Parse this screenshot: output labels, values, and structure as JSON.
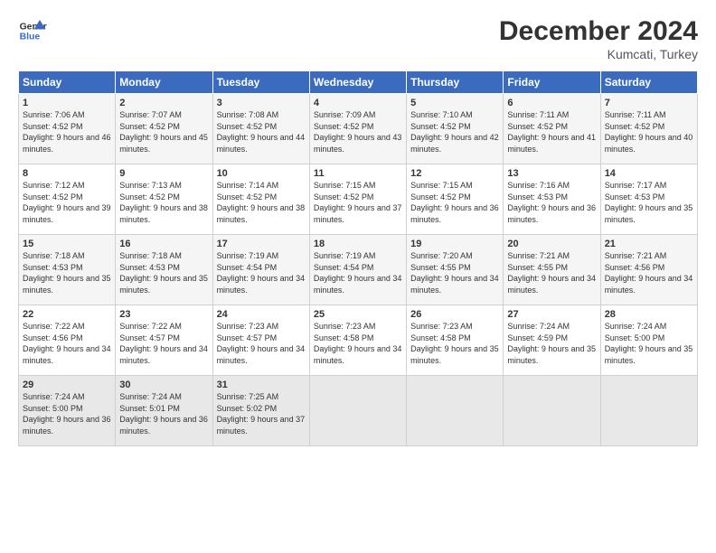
{
  "header": {
    "logo_line1": "General",
    "logo_line2": "Blue",
    "month": "December 2024",
    "location": "Kumcati, Turkey"
  },
  "weekdays": [
    "Sunday",
    "Monday",
    "Tuesday",
    "Wednesday",
    "Thursday",
    "Friday",
    "Saturday"
  ],
  "weeks": [
    [
      {
        "day": "1",
        "sunrise": "7:06 AM",
        "sunset": "4:52 PM",
        "daylight": "9 hours and 46 minutes."
      },
      {
        "day": "2",
        "sunrise": "7:07 AM",
        "sunset": "4:52 PM",
        "daylight": "9 hours and 45 minutes."
      },
      {
        "day": "3",
        "sunrise": "7:08 AM",
        "sunset": "4:52 PM",
        "daylight": "9 hours and 44 minutes."
      },
      {
        "day": "4",
        "sunrise": "7:09 AM",
        "sunset": "4:52 PM",
        "daylight": "9 hours and 43 minutes."
      },
      {
        "day": "5",
        "sunrise": "7:10 AM",
        "sunset": "4:52 PM",
        "daylight": "9 hours and 42 minutes."
      },
      {
        "day": "6",
        "sunrise": "7:11 AM",
        "sunset": "4:52 PM",
        "daylight": "9 hours and 41 minutes."
      },
      {
        "day": "7",
        "sunrise": "7:11 AM",
        "sunset": "4:52 PM",
        "daylight": "9 hours and 40 minutes."
      }
    ],
    [
      {
        "day": "8",
        "sunrise": "7:12 AM",
        "sunset": "4:52 PM",
        "daylight": "9 hours and 39 minutes."
      },
      {
        "day": "9",
        "sunrise": "7:13 AM",
        "sunset": "4:52 PM",
        "daylight": "9 hours and 38 minutes."
      },
      {
        "day": "10",
        "sunrise": "7:14 AM",
        "sunset": "4:52 PM",
        "daylight": "9 hours and 38 minutes."
      },
      {
        "day": "11",
        "sunrise": "7:15 AM",
        "sunset": "4:52 PM",
        "daylight": "9 hours and 37 minutes."
      },
      {
        "day": "12",
        "sunrise": "7:15 AM",
        "sunset": "4:52 PM",
        "daylight": "9 hours and 36 minutes."
      },
      {
        "day": "13",
        "sunrise": "7:16 AM",
        "sunset": "4:53 PM",
        "daylight": "9 hours and 36 minutes."
      },
      {
        "day": "14",
        "sunrise": "7:17 AM",
        "sunset": "4:53 PM",
        "daylight": "9 hours and 35 minutes."
      }
    ],
    [
      {
        "day": "15",
        "sunrise": "7:18 AM",
        "sunset": "4:53 PM",
        "daylight": "9 hours and 35 minutes."
      },
      {
        "day": "16",
        "sunrise": "7:18 AM",
        "sunset": "4:53 PM",
        "daylight": "9 hours and 35 minutes."
      },
      {
        "day": "17",
        "sunrise": "7:19 AM",
        "sunset": "4:54 PM",
        "daylight": "9 hours and 34 minutes."
      },
      {
        "day": "18",
        "sunrise": "7:19 AM",
        "sunset": "4:54 PM",
        "daylight": "9 hours and 34 minutes."
      },
      {
        "day": "19",
        "sunrise": "7:20 AM",
        "sunset": "4:55 PM",
        "daylight": "9 hours and 34 minutes."
      },
      {
        "day": "20",
        "sunrise": "7:21 AM",
        "sunset": "4:55 PM",
        "daylight": "9 hours and 34 minutes."
      },
      {
        "day": "21",
        "sunrise": "7:21 AM",
        "sunset": "4:56 PM",
        "daylight": "9 hours and 34 minutes."
      }
    ],
    [
      {
        "day": "22",
        "sunrise": "7:22 AM",
        "sunset": "4:56 PM",
        "daylight": "9 hours and 34 minutes."
      },
      {
        "day": "23",
        "sunrise": "7:22 AM",
        "sunset": "4:57 PM",
        "daylight": "9 hours and 34 minutes."
      },
      {
        "day": "24",
        "sunrise": "7:23 AM",
        "sunset": "4:57 PM",
        "daylight": "9 hours and 34 minutes."
      },
      {
        "day": "25",
        "sunrise": "7:23 AM",
        "sunset": "4:58 PM",
        "daylight": "9 hours and 34 minutes."
      },
      {
        "day": "26",
        "sunrise": "7:23 AM",
        "sunset": "4:58 PM",
        "daylight": "9 hours and 35 minutes."
      },
      {
        "day": "27",
        "sunrise": "7:24 AM",
        "sunset": "4:59 PM",
        "daylight": "9 hours and 35 minutes."
      },
      {
        "day": "28",
        "sunrise": "7:24 AM",
        "sunset": "5:00 PM",
        "daylight": "9 hours and 35 minutes."
      }
    ],
    [
      {
        "day": "29",
        "sunrise": "7:24 AM",
        "sunset": "5:00 PM",
        "daylight": "9 hours and 36 minutes."
      },
      {
        "day": "30",
        "sunrise": "7:24 AM",
        "sunset": "5:01 PM",
        "daylight": "9 hours and 36 minutes."
      },
      {
        "day": "31",
        "sunrise": "7:25 AM",
        "sunset": "5:02 PM",
        "daylight": "9 hours and 37 minutes."
      },
      null,
      null,
      null,
      null
    ]
  ]
}
